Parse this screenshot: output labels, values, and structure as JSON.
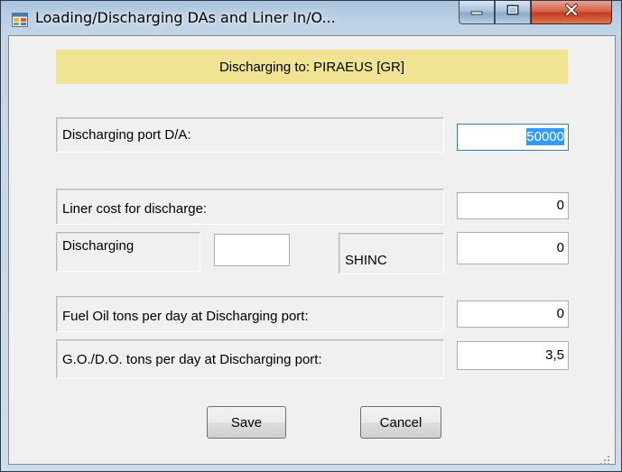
{
  "window": {
    "title": "Loading/Discharging DAs and Liner In/O..."
  },
  "banner": {
    "text": "Discharging to: PIRAEUS [GR]"
  },
  "fields": {
    "port_da_label": "Discharging port D/A:",
    "port_da_value": "50000",
    "liner_cost_label": "Liner cost for discharge:",
    "liner_cost_value": "0",
    "discharging_label": "Discharging",
    "discharging_value": "",
    "terms_label": "SHINC",
    "terms_value": "0",
    "fuel_oil_label": "Fuel Oil tons per day at Discharging port:",
    "fuel_oil_value": "0",
    "go_do_label": "G.O./D.O. tons per day at Discharging port:",
    "go_do_value": "3,5"
  },
  "buttons": {
    "save_label": "Save",
    "cancel_label": "Cancel"
  },
  "icons": {
    "app": "app-window-icon",
    "minimize": "minimize-icon",
    "maximize": "maximize-icon",
    "close": "close-icon",
    "grip": "resize-grip-icon"
  },
  "colors": {
    "banner_bg": "#f1e394",
    "selection": "#3399ff",
    "close_button": "#c23a1f"
  }
}
